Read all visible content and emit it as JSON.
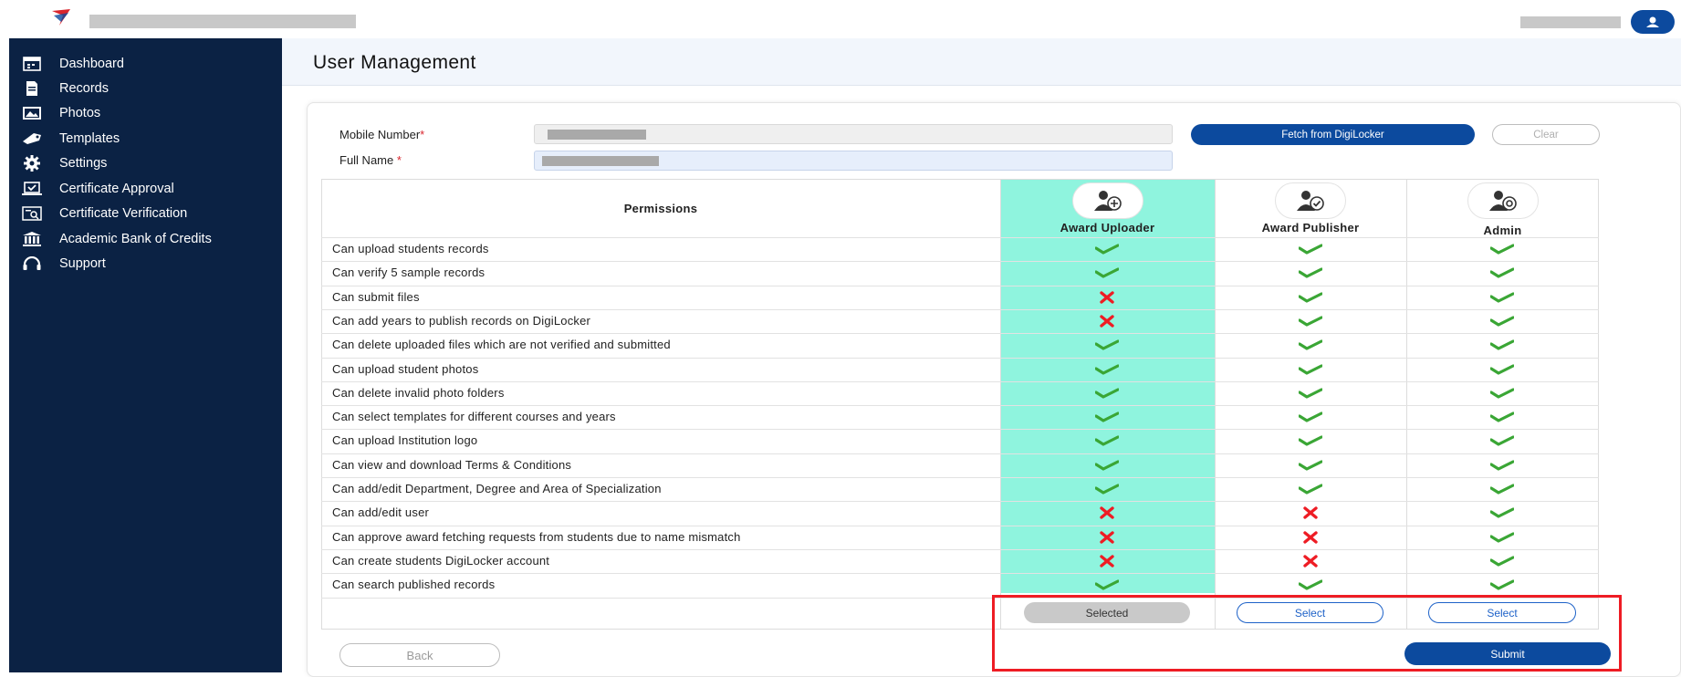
{
  "header": {
    "avatar_icon": "user-circle-icon"
  },
  "sidebar": {
    "items": [
      {
        "label": "Dashboard",
        "icon": "calendar-icon"
      },
      {
        "label": "Records",
        "icon": "document-stack-icon"
      },
      {
        "label": "Photos",
        "icon": "photo-icon"
      },
      {
        "label": "Templates",
        "icon": "tag-icon"
      },
      {
        "label": "Settings",
        "icon": "gear-icon"
      },
      {
        "label": "Certificate Approval",
        "icon": "laptop-check-icon"
      },
      {
        "label": "Certificate Verification",
        "icon": "certificate-search-icon"
      },
      {
        "label": "Academic Bank of Credits",
        "icon": "bank-icon"
      },
      {
        "label": "Support",
        "icon": "headset-icon"
      }
    ]
  },
  "page": {
    "title": "User Management"
  },
  "form": {
    "mobile_label": "Mobile Number",
    "full_name_label": "Full Name ",
    "required_mark": "*",
    "fetch_button": "Fetch from DigiLocker",
    "clear_button": "Clear"
  },
  "table": {
    "permissions_header": "Permissions",
    "roles": [
      {
        "label": "Award Uploader",
        "icon": "user-add-icon",
        "action": "Selected"
      },
      {
        "label": "Award Publisher",
        "icon": "user-check-icon",
        "action": "Select"
      },
      {
        "label": "Admin",
        "icon": "user-gear-icon",
        "action": "Select"
      }
    ],
    "rows": [
      {
        "permission": "Can upload students records",
        "grants": [
          true,
          true,
          true
        ]
      },
      {
        "permission": "Can verify 5 sample records",
        "grants": [
          true,
          true,
          true
        ]
      },
      {
        "permission": "Can submit files",
        "grants": [
          false,
          true,
          true
        ]
      },
      {
        "permission": "Can add years to publish records on DigiLocker",
        "grants": [
          false,
          true,
          true
        ]
      },
      {
        "permission": "Can delete uploaded files which are not verified and submitted",
        "grants": [
          true,
          true,
          true
        ]
      },
      {
        "permission": "Can upload student photos",
        "grants": [
          true,
          true,
          true
        ]
      },
      {
        "permission": "Can delete invalid photo folders",
        "grants": [
          true,
          true,
          true
        ]
      },
      {
        "permission": "Can select templates for different courses and years",
        "grants": [
          true,
          true,
          true
        ]
      },
      {
        "permission": "Can upload Institution logo",
        "grants": [
          true,
          true,
          true
        ]
      },
      {
        "permission": "Can view and download Terms & Conditions",
        "grants": [
          true,
          true,
          true
        ]
      },
      {
        "permission": "Can add/edit Department, Degree and Area of Specialization",
        "grants": [
          true,
          true,
          true
        ]
      },
      {
        "permission": "Can add/edit user",
        "grants": [
          false,
          false,
          true
        ]
      },
      {
        "permission": "Can approve award fetching requests from students due to name mismatch",
        "grants": [
          false,
          false,
          true
        ]
      },
      {
        "permission": "Can create students DigiLocker account",
        "grants": [
          false,
          false,
          true
        ]
      },
      {
        "permission": "Can search published records",
        "grants": [
          true,
          true,
          true
        ]
      }
    ]
  },
  "footer": {
    "back_button": "Back",
    "submit_button": "Submit"
  },
  "colors": {
    "sidebar": "#0b2244",
    "primary": "#0c4a9e",
    "highlight": "#8ff4de",
    "check": "#3aa635",
    "cross": "#ee1c24",
    "annotation": "#ee1c24"
  }
}
